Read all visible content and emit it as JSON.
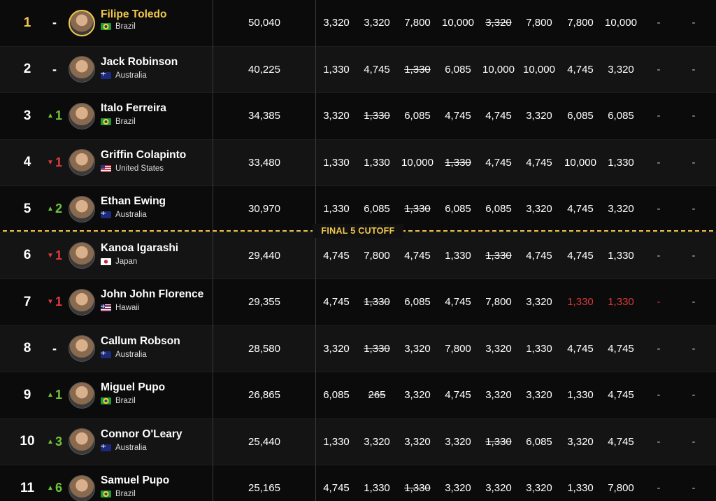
{
  "cutoff": {
    "label": "FINAL 5 CUTOFF",
    "after_rank": 5,
    "color": "#f2c94c"
  },
  "colors": {
    "leader": "#f2c94c",
    "up": "#6fc53a",
    "down": "#e0393e",
    "injured": "#d63a3a"
  },
  "rows": [
    {
      "rank": "1",
      "change": {
        "dir": "none",
        "value": "-"
      },
      "name": "Filipe Toledo",
      "country": "Brazil",
      "flag": "flag-brazil",
      "leader": true,
      "total": "50,040",
      "results": [
        {
          "v": "3,320"
        },
        {
          "v": "3,320"
        },
        {
          "v": "7,800"
        },
        {
          "v": "10,000"
        },
        {
          "v": "3,320",
          "dropped": true
        },
        {
          "v": "7,800"
        },
        {
          "v": "7,800"
        },
        {
          "v": "10,000"
        },
        {
          "v": "-"
        },
        {
          "v": "-"
        }
      ]
    },
    {
      "rank": "2",
      "change": {
        "dir": "none",
        "value": "-"
      },
      "name": "Jack Robinson",
      "country": "Australia",
      "flag": "flag-australia",
      "total": "40,225",
      "results": [
        {
          "v": "1,330"
        },
        {
          "v": "4,745"
        },
        {
          "v": "1,330",
          "dropped": true
        },
        {
          "v": "6,085"
        },
        {
          "v": "10,000"
        },
        {
          "v": "10,000"
        },
        {
          "v": "4,745"
        },
        {
          "v": "3,320"
        },
        {
          "v": "-"
        },
        {
          "v": "-"
        }
      ]
    },
    {
      "rank": "3",
      "change": {
        "dir": "up",
        "value": "1"
      },
      "name": "Italo Ferreira",
      "country": "Brazil",
      "flag": "flag-brazil",
      "total": "34,385",
      "results": [
        {
          "v": "3,320"
        },
        {
          "v": "1,330",
          "dropped": true
        },
        {
          "v": "6,085"
        },
        {
          "v": "4,745"
        },
        {
          "v": "4,745"
        },
        {
          "v": "3,320"
        },
        {
          "v": "6,085"
        },
        {
          "v": "6,085"
        },
        {
          "v": "-"
        },
        {
          "v": "-"
        }
      ]
    },
    {
      "rank": "4",
      "change": {
        "dir": "down",
        "value": "1"
      },
      "name": "Griffin Colapinto",
      "country": "United States",
      "flag": "flag-usa",
      "total": "33,480",
      "results": [
        {
          "v": "1,330"
        },
        {
          "v": "1,330"
        },
        {
          "v": "10,000"
        },
        {
          "v": "1,330",
          "dropped": true
        },
        {
          "v": "4,745"
        },
        {
          "v": "4,745"
        },
        {
          "v": "10,000"
        },
        {
          "v": "1,330"
        },
        {
          "v": "-"
        },
        {
          "v": "-"
        }
      ]
    },
    {
      "rank": "5",
      "change": {
        "dir": "up",
        "value": "2"
      },
      "name": "Ethan Ewing",
      "country": "Australia",
      "flag": "flag-australia",
      "total": "30,970",
      "results": [
        {
          "v": "1,330"
        },
        {
          "v": "6,085"
        },
        {
          "v": "1,330",
          "dropped": true
        },
        {
          "v": "6,085"
        },
        {
          "v": "6,085"
        },
        {
          "v": "3,320"
        },
        {
          "v": "4,745"
        },
        {
          "v": "3,320"
        },
        {
          "v": "-"
        },
        {
          "v": "-"
        }
      ]
    },
    {
      "rank": "6",
      "change": {
        "dir": "down",
        "value": "1"
      },
      "name": "Kanoa Igarashi",
      "country": "Japan",
      "flag": "flag-japan",
      "total": "29,440",
      "results": [
        {
          "v": "4,745"
        },
        {
          "v": "7,800"
        },
        {
          "v": "4,745"
        },
        {
          "v": "1,330"
        },
        {
          "v": "1,330",
          "dropped": true
        },
        {
          "v": "4,745"
        },
        {
          "v": "4,745"
        },
        {
          "v": "1,330"
        },
        {
          "v": "-"
        },
        {
          "v": "-"
        }
      ]
    },
    {
      "rank": "7",
      "change": {
        "dir": "down",
        "value": "1"
      },
      "name": "John John Florence",
      "country": "Hawaii",
      "flag": "flag-hawaii",
      "total": "29,355",
      "results": [
        {
          "v": "4,745"
        },
        {
          "v": "1,330",
          "dropped": true
        },
        {
          "v": "6,085"
        },
        {
          "v": "4,745"
        },
        {
          "v": "7,800"
        },
        {
          "v": "3,320"
        },
        {
          "v": "1,330",
          "red": true
        },
        {
          "v": "1,330",
          "red": true
        },
        {
          "v": "-",
          "red": true
        },
        {
          "v": "-"
        }
      ]
    },
    {
      "rank": "8",
      "change": {
        "dir": "none",
        "value": "-"
      },
      "name": "Callum Robson",
      "country": "Australia",
      "flag": "flag-australia",
      "total": "28,580",
      "results": [
        {
          "v": "3,320"
        },
        {
          "v": "1,330",
          "dropped": true
        },
        {
          "v": "3,320"
        },
        {
          "v": "7,800"
        },
        {
          "v": "3,320"
        },
        {
          "v": "1,330"
        },
        {
          "v": "4,745"
        },
        {
          "v": "4,745"
        },
        {
          "v": "-"
        },
        {
          "v": "-"
        }
      ]
    },
    {
      "rank": "9",
      "change": {
        "dir": "up",
        "value": "1"
      },
      "name": "Miguel Pupo",
      "country": "Brazil",
      "flag": "flag-brazil",
      "total": "26,865",
      "results": [
        {
          "v": "6,085"
        },
        {
          "v": "265",
          "dropped": true
        },
        {
          "v": "3,320"
        },
        {
          "v": "4,745"
        },
        {
          "v": "3,320"
        },
        {
          "v": "3,320"
        },
        {
          "v": "1,330"
        },
        {
          "v": "4,745"
        },
        {
          "v": "-"
        },
        {
          "v": "-"
        }
      ]
    },
    {
      "rank": "10",
      "change": {
        "dir": "up",
        "value": "3"
      },
      "name": "Connor O'Leary",
      "country": "Australia",
      "flag": "flag-australia",
      "total": "25,440",
      "results": [
        {
          "v": "1,330"
        },
        {
          "v": "3,320"
        },
        {
          "v": "3,320"
        },
        {
          "v": "3,320"
        },
        {
          "v": "1,330",
          "dropped": true
        },
        {
          "v": "6,085"
        },
        {
          "v": "3,320"
        },
        {
          "v": "4,745"
        },
        {
          "v": "-"
        },
        {
          "v": "-"
        }
      ]
    },
    {
      "rank": "11",
      "change": {
        "dir": "up",
        "value": "6"
      },
      "name": "Samuel Pupo",
      "country": "Brazil",
      "flag": "flag-brazil",
      "total": "25,165",
      "results": [
        {
          "v": "4,745"
        },
        {
          "v": "1,330"
        },
        {
          "v": "1,330",
          "dropped": true
        },
        {
          "v": "3,320"
        },
        {
          "v": "3,320"
        },
        {
          "v": "3,320"
        },
        {
          "v": "1,330"
        },
        {
          "v": "7,800"
        },
        {
          "v": "-"
        },
        {
          "v": "-"
        }
      ]
    }
  ]
}
